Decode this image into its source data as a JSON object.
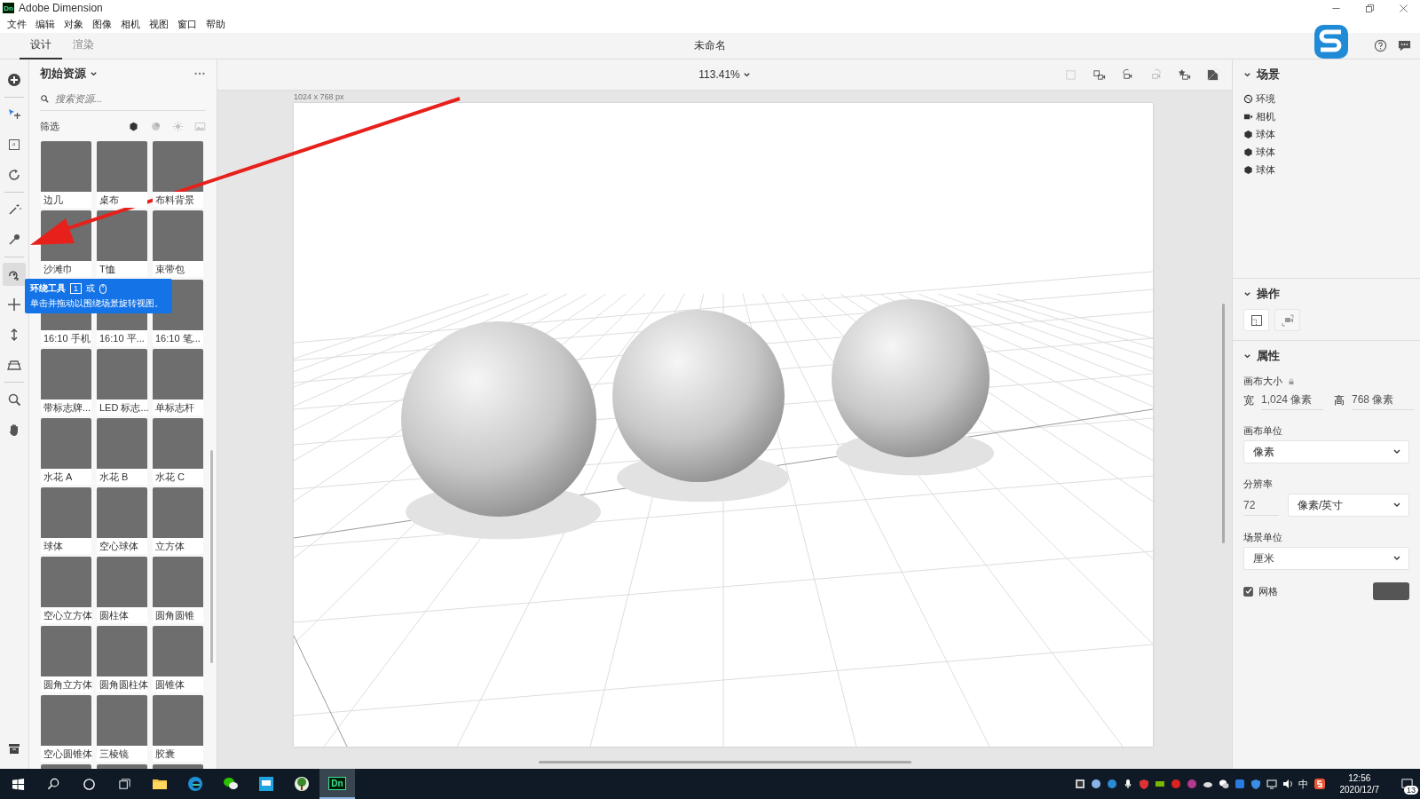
{
  "app": {
    "logo": "Dn",
    "title": "Adobe Dimension"
  },
  "menu": [
    "文件",
    "编辑",
    "对象",
    "图像",
    "相机",
    "视图",
    "窗口",
    "帮助"
  ],
  "mode_tabs": [
    {
      "label": "设计",
      "selected": true
    },
    {
      "label": "渲染",
      "selected": false
    }
  ],
  "document_title": "未命名",
  "tools": [
    {
      "kind": "add",
      "selected": false
    },
    {
      "kind": "select",
      "selected": false
    },
    {
      "kind": "frame",
      "selected": false
    },
    {
      "kind": "rotate",
      "selected": false
    },
    {
      "kind": "wand",
      "selected": false
    },
    {
      "kind": "dropper",
      "selected": false
    },
    {
      "kind": "orbit",
      "selected": true
    },
    {
      "kind": "pan",
      "selected": false
    },
    {
      "kind": "dolly",
      "selected": false
    },
    {
      "kind": "horizon",
      "selected": false
    },
    {
      "kind": "zoom",
      "selected": false
    },
    {
      "kind": "hand",
      "selected": false
    }
  ],
  "assets": {
    "title": "初始资源",
    "search": {
      "placeholder": "搜索资源..."
    },
    "filter_label": "筛选",
    "filters": [
      {
        "kind": "models",
        "selected": true
      },
      {
        "kind": "materials",
        "selected": false
      },
      {
        "kind": "lights",
        "selected": false
      },
      {
        "kind": "images",
        "selected": false
      }
    ],
    "items": [
      "边几",
      "桌布",
      "布料背景",
      "沙滩巾",
      "T恤",
      "束带包",
      "16:10 手机",
      "16:10 平...",
      "16:10 笔...",
      "带标志牌...",
      "LED 标志...",
      "单标志杆",
      "水花 A",
      "水花 B",
      "水花 C",
      "球体",
      "空心球体",
      "立方体",
      "空心立方体",
      "圆柱体",
      "圆角圆锥",
      "圆角立方体",
      "圆角圆柱体",
      "圆锥体",
      "空心圆锥体",
      "三棱镜",
      "胶囊"
    ]
  },
  "tooltip": {
    "title": "环绕工具",
    "key": "1",
    "joiner": "或",
    "description": "单击并拖动以围绕场景旋转视图。"
  },
  "viewport": {
    "zoom": "113.41%",
    "canvas_size": "1024 x 768 px"
  },
  "scene": {
    "title": "场景",
    "expanded": true,
    "items": [
      {
        "kind": "environment",
        "label": "环境"
      },
      {
        "kind": "camera",
        "label": "相机"
      },
      {
        "kind": "object",
        "label": "球体"
      },
      {
        "kind": "object",
        "label": "球体"
      },
      {
        "kind": "object",
        "label": "球体"
      }
    ]
  },
  "actions": {
    "title": "操作",
    "expanded": true,
    "buttons": [
      {
        "kind": "fit",
        "disabled": false
      },
      {
        "kind": "camera",
        "disabled": true
      }
    ]
  },
  "properties": {
    "title": "属性",
    "expanded": true,
    "canvas_size_label": "画布大小",
    "width_label": "宽",
    "width": "1,024 像素",
    "height_label": "高",
    "height": "768 像素",
    "canvas_unit_label": "画布单位",
    "canvas_unit": "像素",
    "resolution_label": "分辨率",
    "resolution": "72",
    "resolution_unit": "像素/英寸",
    "scene_unit_label": "场景单位",
    "scene_unit": "厘米",
    "grid": {
      "label": "网格",
      "checked": true,
      "color": "#555555"
    }
  },
  "taskbar": {
    "apps": [
      {
        "kind": "explorer",
        "selected": false
      },
      {
        "kind": "edge",
        "selected": false
      },
      {
        "kind": "wechat",
        "selected": false
      },
      {
        "kind": "editor",
        "selected": false
      },
      {
        "kind": "tree",
        "selected": false
      },
      {
        "kind": "dimension",
        "label": "Dn",
        "selected": true
      }
    ],
    "ime": "中",
    "time": "12:56",
    "date": "2020/12/7",
    "notifications": "13"
  }
}
